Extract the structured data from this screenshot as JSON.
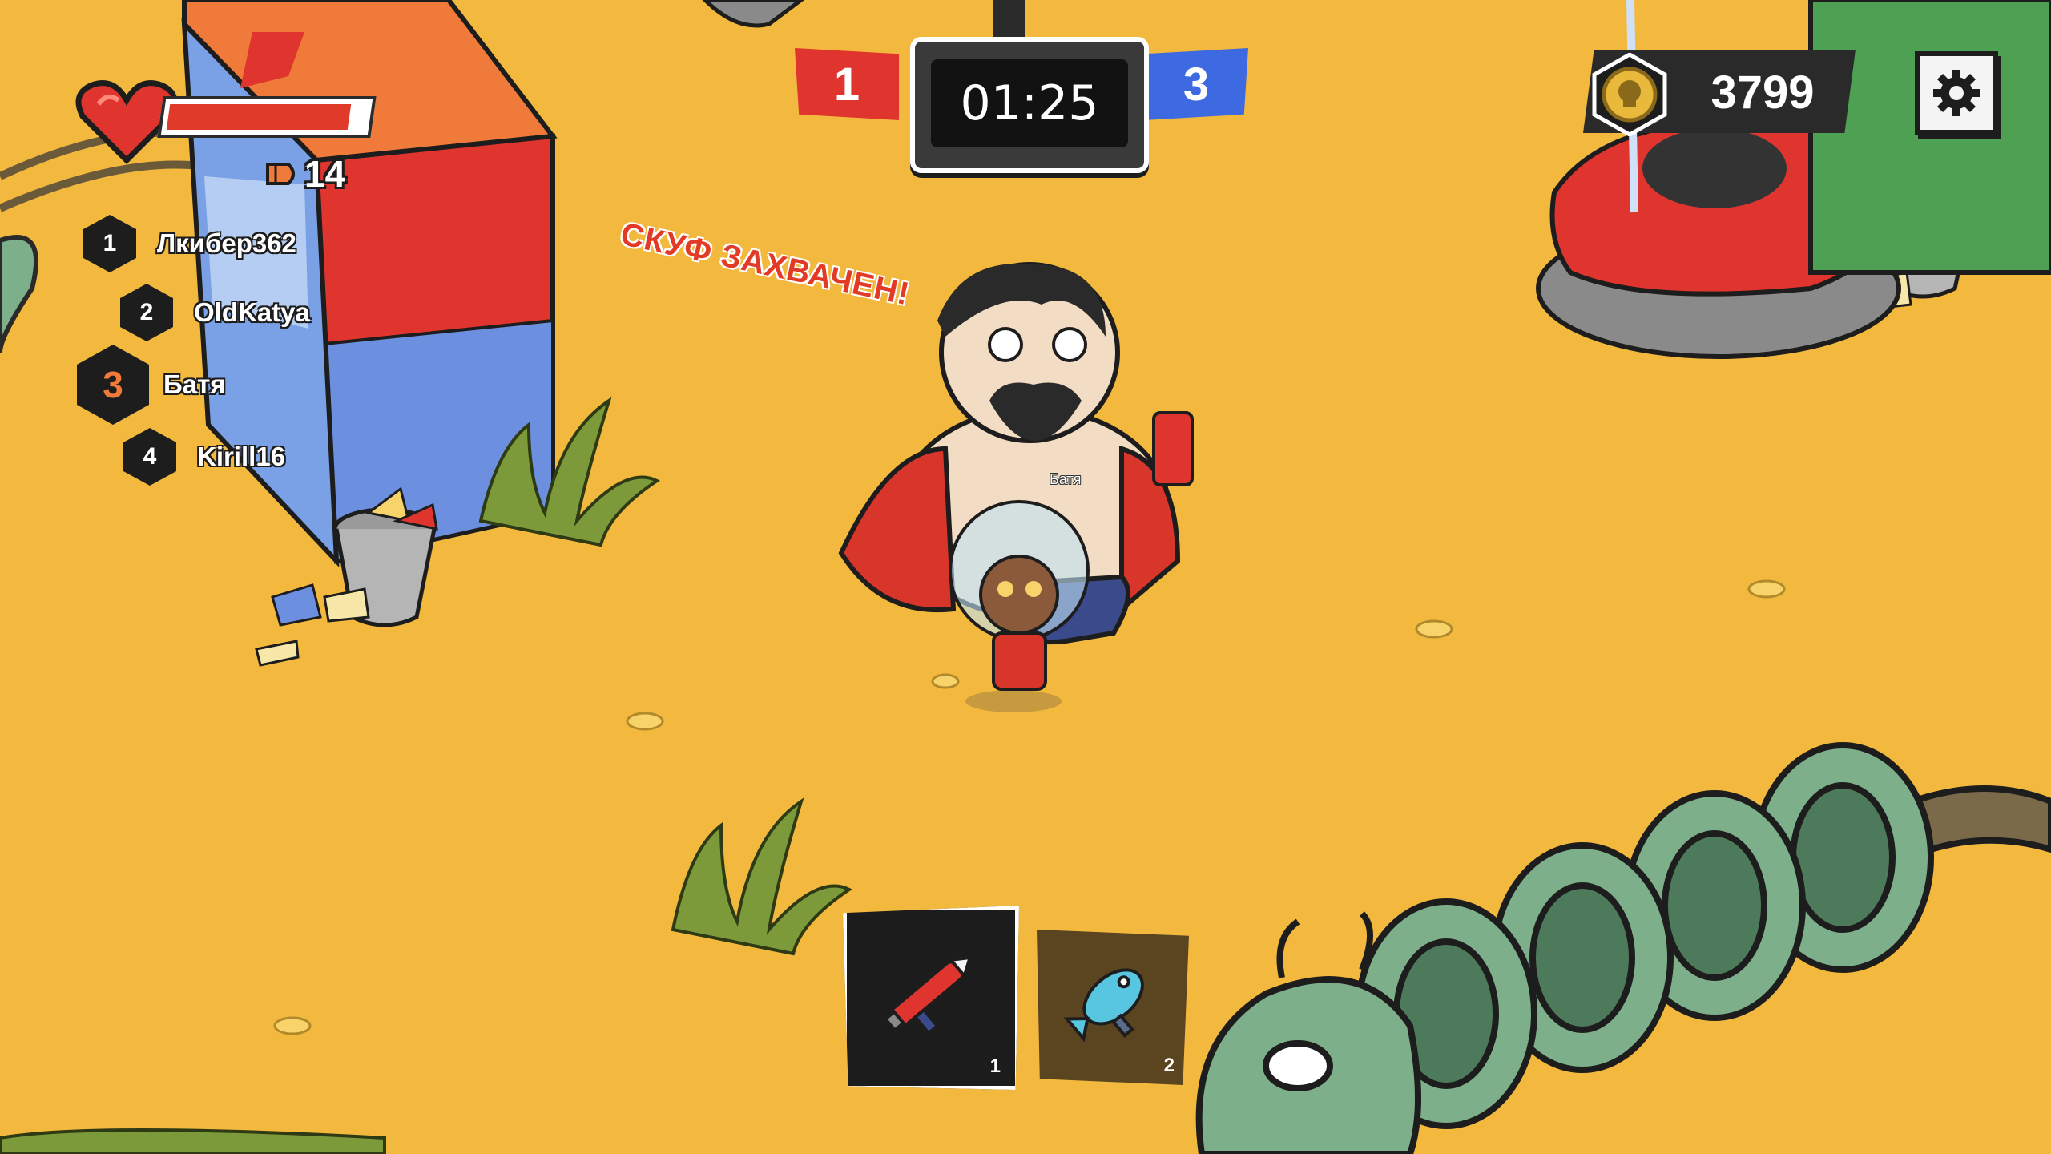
{
  "hud": {
    "health_fraction": 0.92,
    "ammo": "14",
    "leaderboard": [
      {
        "rank": "1",
        "name": "Лкибер362"
      },
      {
        "rank": "2",
        "name": "OldKatya"
      },
      {
        "rank": "3",
        "name": "Батя"
      },
      {
        "rank": "4",
        "name": "Kirill16"
      }
    ],
    "score_red": "1",
    "score_blue": "3",
    "timer": "01:25",
    "coins": "3799",
    "capture_message": "СКУФ ЗАХВАЧЕН!",
    "player_nametag": "Батя",
    "weapon_slots": [
      {
        "number": "1",
        "icon": "rocket-launcher-icon",
        "selected": true
      },
      {
        "number": "2",
        "icon": "fish-blaster-icon",
        "selected": false
      }
    ]
  },
  "colors": {
    "ground": "#f3b83e",
    "team_red": "#e0352e",
    "team_blue": "#3d6ae0",
    "health": "#e03a2a"
  }
}
